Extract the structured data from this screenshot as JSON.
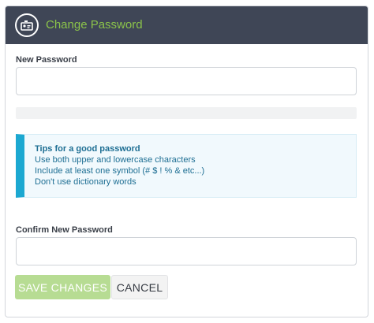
{
  "header": {
    "title": "Change Password",
    "icon": "id-card-icon",
    "background_color": "#3f4656",
    "title_color": "#8bc34a"
  },
  "new_password": {
    "label": "New Password",
    "value": "",
    "placeholder": ""
  },
  "strength_meter": {
    "level": 0
  },
  "tips": {
    "title": "Tips for a good password",
    "lines": [
      "Use both upper and lowercase characters",
      "Include at least one symbol (# $ ! % & etc...)",
      "Don't use dictionary words"
    ],
    "accent_color": "#1ca8d1"
  },
  "confirm_password": {
    "label": "Confirm New Password",
    "value": "",
    "placeholder": ""
  },
  "actions": {
    "save_label": "SAVE CHANGES",
    "cancel_label": "CANCEL",
    "save_color": "#b7dc93"
  }
}
